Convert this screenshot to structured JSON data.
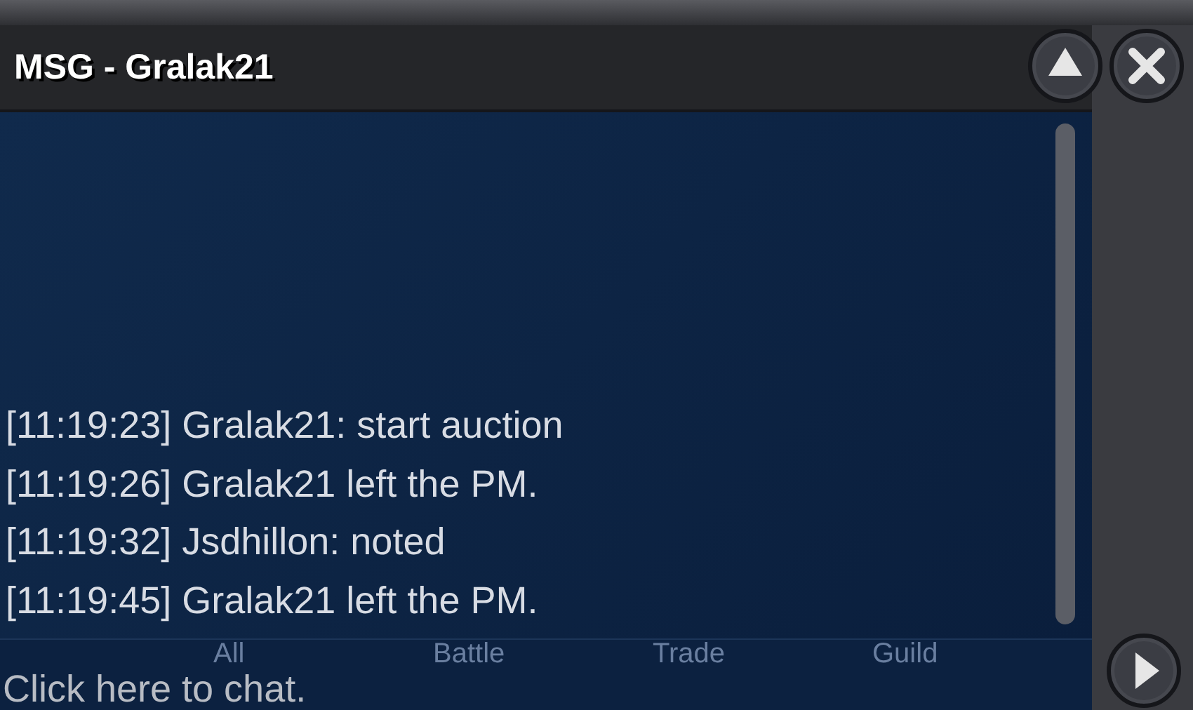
{
  "window": {
    "title": "MSG - Gralak21"
  },
  "messages": [
    "[11:19:23] Gralak21: start auction",
    "[11:19:26] Gralak21 left the PM.",
    "[11:19:32] Jsdhillon: noted",
    "[11:19:45] Gralak21 left the PM."
  ],
  "tabs": [
    "All",
    "Battle",
    "Trade",
    "Guild"
  ],
  "input": {
    "placeholder": "Click here to chat."
  }
}
